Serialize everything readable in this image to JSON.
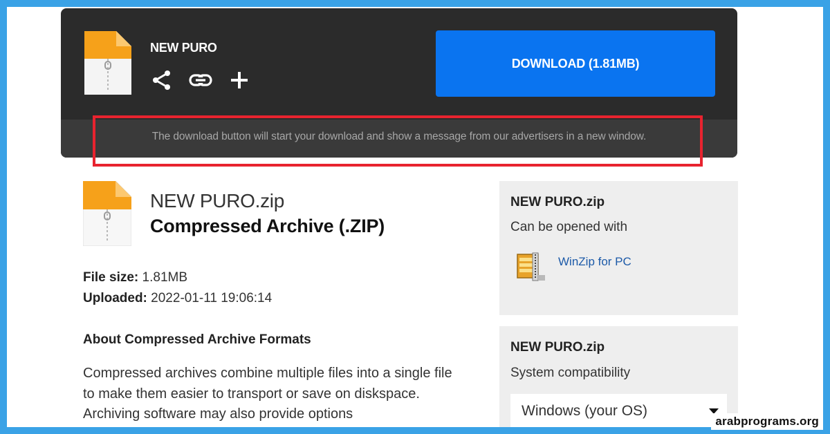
{
  "header": {
    "title": "NEW PURO",
    "download_label": "DOWNLOAD (1.81MB)",
    "notice": "The download button will start your download and show a message from our advertisers in a new window.",
    "icons": [
      "share-icon",
      "link-icon",
      "plus-icon"
    ]
  },
  "file": {
    "name": "NEW PURO.zip",
    "type": "Compressed Archive (.ZIP)",
    "size_label": "File size:",
    "size": "1.81MB",
    "uploaded_label": "Uploaded:",
    "uploaded": "2022-01-11 19:06:14"
  },
  "about": {
    "title": "About Compressed Archive Formats",
    "body": "Compressed archives combine multiple files into a single file to make them easier to transport or save on diskspace. Archiving software may also provide options"
  },
  "open_with": {
    "title": "NEW PURO.zip",
    "subtitle": "Can be opened with",
    "app": "WinZip for PC"
  },
  "compat": {
    "title": "NEW PURO.zip",
    "subtitle": "System compatibility",
    "selected_os": "Windows (your OS)"
  },
  "watermark": "arabprograms.org",
  "colors": {
    "frame": "#3aa2e6",
    "header_bg": "#2b2b2b",
    "download_button": "#0a74f0",
    "highlight_box": "#e8232f",
    "file_icon_orange": "#f6a11a"
  }
}
